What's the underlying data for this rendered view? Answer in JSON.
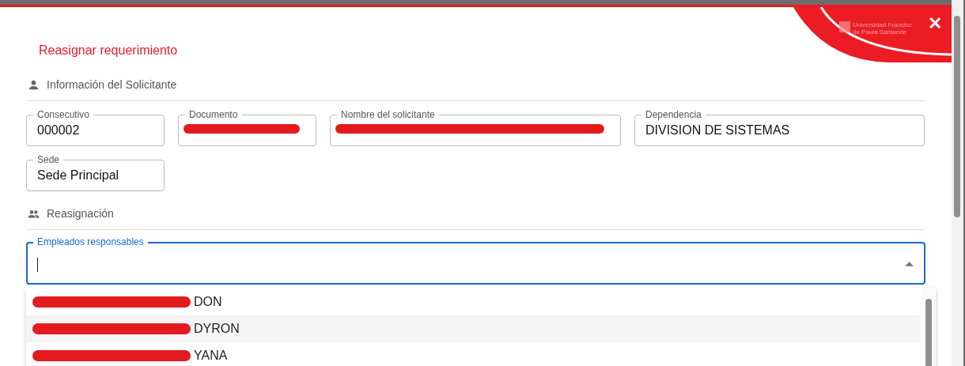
{
  "dialog": {
    "title": "Reasignar requerimiento",
    "logo": {
      "line1": "Universidad Francisc",
      "line2": "de Paula Santande"
    },
    "close": "✕"
  },
  "applicant_section": {
    "title": "Información del Solicitante",
    "fields": [
      {
        "label": "Consecutivo",
        "value": "000002",
        "redacted": false
      },
      {
        "label": "Documento",
        "redacted": true
      },
      {
        "label": "Nombre del solicitante",
        "redacted": true
      },
      {
        "label": "Dependencia",
        "value": "DIVISION DE SISTEMAS",
        "redacted": false
      },
      {
        "label": "Sede",
        "value": "Sede Principal",
        "redacted": false
      }
    ]
  },
  "reassign_section": {
    "title": "Reasignación",
    "autocomplete": {
      "label": "Empleados responsables",
      "focused": true,
      "expanded": true
    },
    "options": [
      {
        "text": "DON",
        "redacted": true,
        "highlighted": false
      },
      {
        "text": "DYRON",
        "redacted": true,
        "highlighted": true
      },
      {
        "text": "YANA",
        "redacted": true,
        "highlighted": false
      }
    ]
  }
}
